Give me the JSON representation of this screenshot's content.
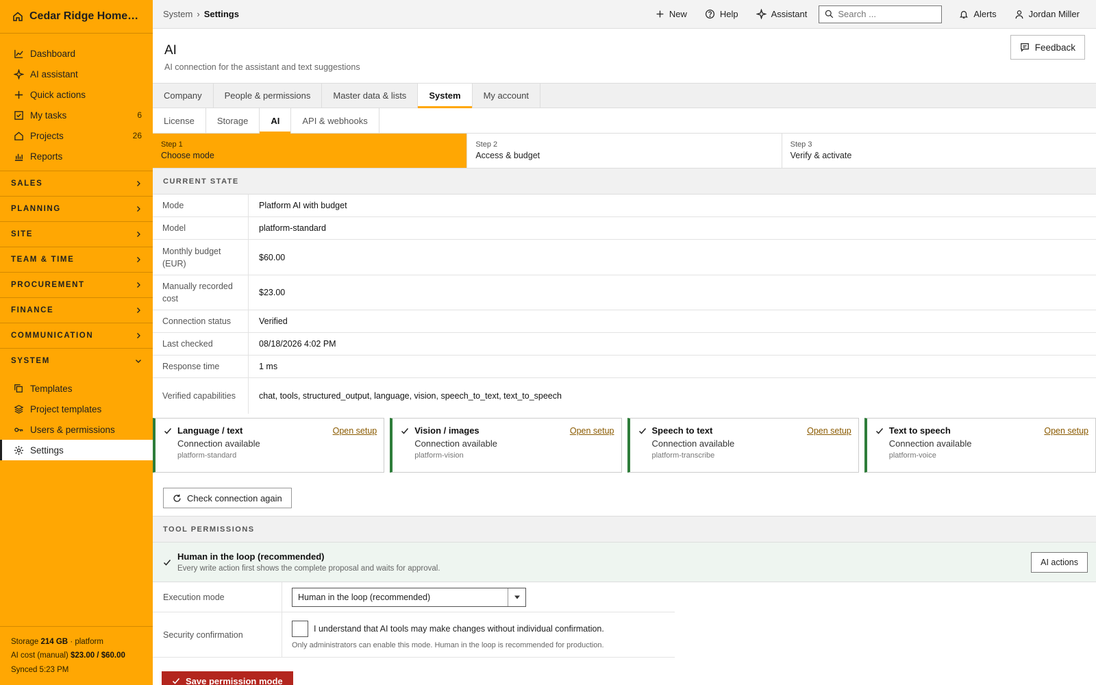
{
  "app": {
    "title": "Cedar Ridge Homes L..."
  },
  "sidebar": {
    "items": [
      {
        "label": "Dashboard",
        "icon": "chart-line-icon"
      },
      {
        "label": "AI assistant",
        "icon": "sparkle-icon"
      },
      {
        "label": "Quick actions",
        "icon": "plus-icon"
      },
      {
        "label": "My tasks",
        "icon": "checkbox-icon",
        "count": "6"
      },
      {
        "label": "Projects",
        "icon": "home-icon",
        "count": "26"
      },
      {
        "label": "Reports",
        "icon": "bar-chart-icon"
      }
    ],
    "sections": [
      "SALES",
      "PLANNING",
      "SITE",
      "TEAM & TIME",
      "PROCUREMENT",
      "FINANCE",
      "COMMUNICATION",
      "SYSTEM"
    ],
    "system_items": [
      {
        "label": "Templates",
        "icon": "copy-icon"
      },
      {
        "label": "Project templates",
        "icon": "layers-icon"
      },
      {
        "label": "Users & permissions",
        "icon": "key-icon"
      },
      {
        "label": "Settings",
        "icon": "gear-icon",
        "active": true
      }
    ],
    "footer": {
      "storage_label": "Storage",
      "storage_value": "214 GB",
      "storage_suffix": "· platform",
      "cost_label": "AI cost (manual)",
      "cost_value": "$23.00 / $60.00",
      "synced": "Synced 5:23 PM"
    }
  },
  "topbar": {
    "breadcrumb": [
      "System",
      "Settings"
    ],
    "new_label": "New",
    "help_label": "Help",
    "assistant_label": "Assistant",
    "search_placeholder": "Search ...",
    "alerts_label": "Alerts",
    "user_name": "Jordan Miller"
  },
  "page": {
    "title": "AI",
    "subtitle": "AI connection for the assistant and text suggestions",
    "feedback_label": "Feedback"
  },
  "tabs": [
    "Company",
    "People & permissions",
    "Master data & lists",
    "System",
    "My account"
  ],
  "active_tab": "System",
  "subtabs": [
    "License",
    "Storage",
    "AI",
    "API & webhooks"
  ],
  "active_subtab": "AI",
  "steps": [
    {
      "num": "Step 1",
      "label": "Choose mode",
      "active": true
    },
    {
      "num": "Step 2",
      "label": "Access & budget"
    },
    {
      "num": "Step 3",
      "label": "Verify & activate"
    }
  ],
  "current_state": {
    "heading": "CURRENT STATE",
    "rows": [
      {
        "key": "Mode",
        "value": "Platform AI with budget"
      },
      {
        "key": "Model",
        "value": "platform-standard"
      },
      {
        "key": "Monthly budget (EUR)",
        "value": "$60.00"
      },
      {
        "key": "Manually recorded cost",
        "value": "$23.00"
      },
      {
        "key": "Connection status",
        "value": "Verified"
      },
      {
        "key": "Last checked",
        "value": "08/18/2026 4:02 PM"
      },
      {
        "key": "Response time",
        "value": "1 ms"
      },
      {
        "key": "Verified capabilities",
        "value": "chat, tools, structured_output, language, vision, speech_to_text, text_to_speech"
      }
    ]
  },
  "capabilities": [
    {
      "title": "Language / text",
      "status": "Connection available",
      "model": "platform-standard",
      "link": "Open setup"
    },
    {
      "title": "Vision / images",
      "status": "Connection available",
      "model": "platform-vision",
      "link": "Open setup"
    },
    {
      "title": "Speech to text",
      "status": "Connection available",
      "model": "platform-transcribe",
      "link": "Open setup"
    },
    {
      "title": "Text to speech",
      "status": "Connection available",
      "model": "platform-voice",
      "link": "Open setup"
    }
  ],
  "check_again_label": "Check connection again",
  "tool_permissions": {
    "heading": "TOOL PERMISSIONS",
    "mode_title": "Human in the loop (recommended)",
    "mode_desc": "Every write action first shows the complete proposal and waits for approval.",
    "ai_actions_label": "AI actions",
    "execution_label": "Execution mode",
    "execution_value": "Human in the loop (recommended)",
    "security_label": "Security confirmation",
    "security_checkbox_label": "I understand that AI tools may make changes without individual confirmation.",
    "security_note": "Only administrators can enable this mode. Human in the loop is recommended for production.",
    "save_label": "Save permission mode"
  },
  "colors": {
    "accent": "#ffa703",
    "success": "#2e7d3a",
    "danger": "#b3261e",
    "link": "#8a5a00"
  }
}
